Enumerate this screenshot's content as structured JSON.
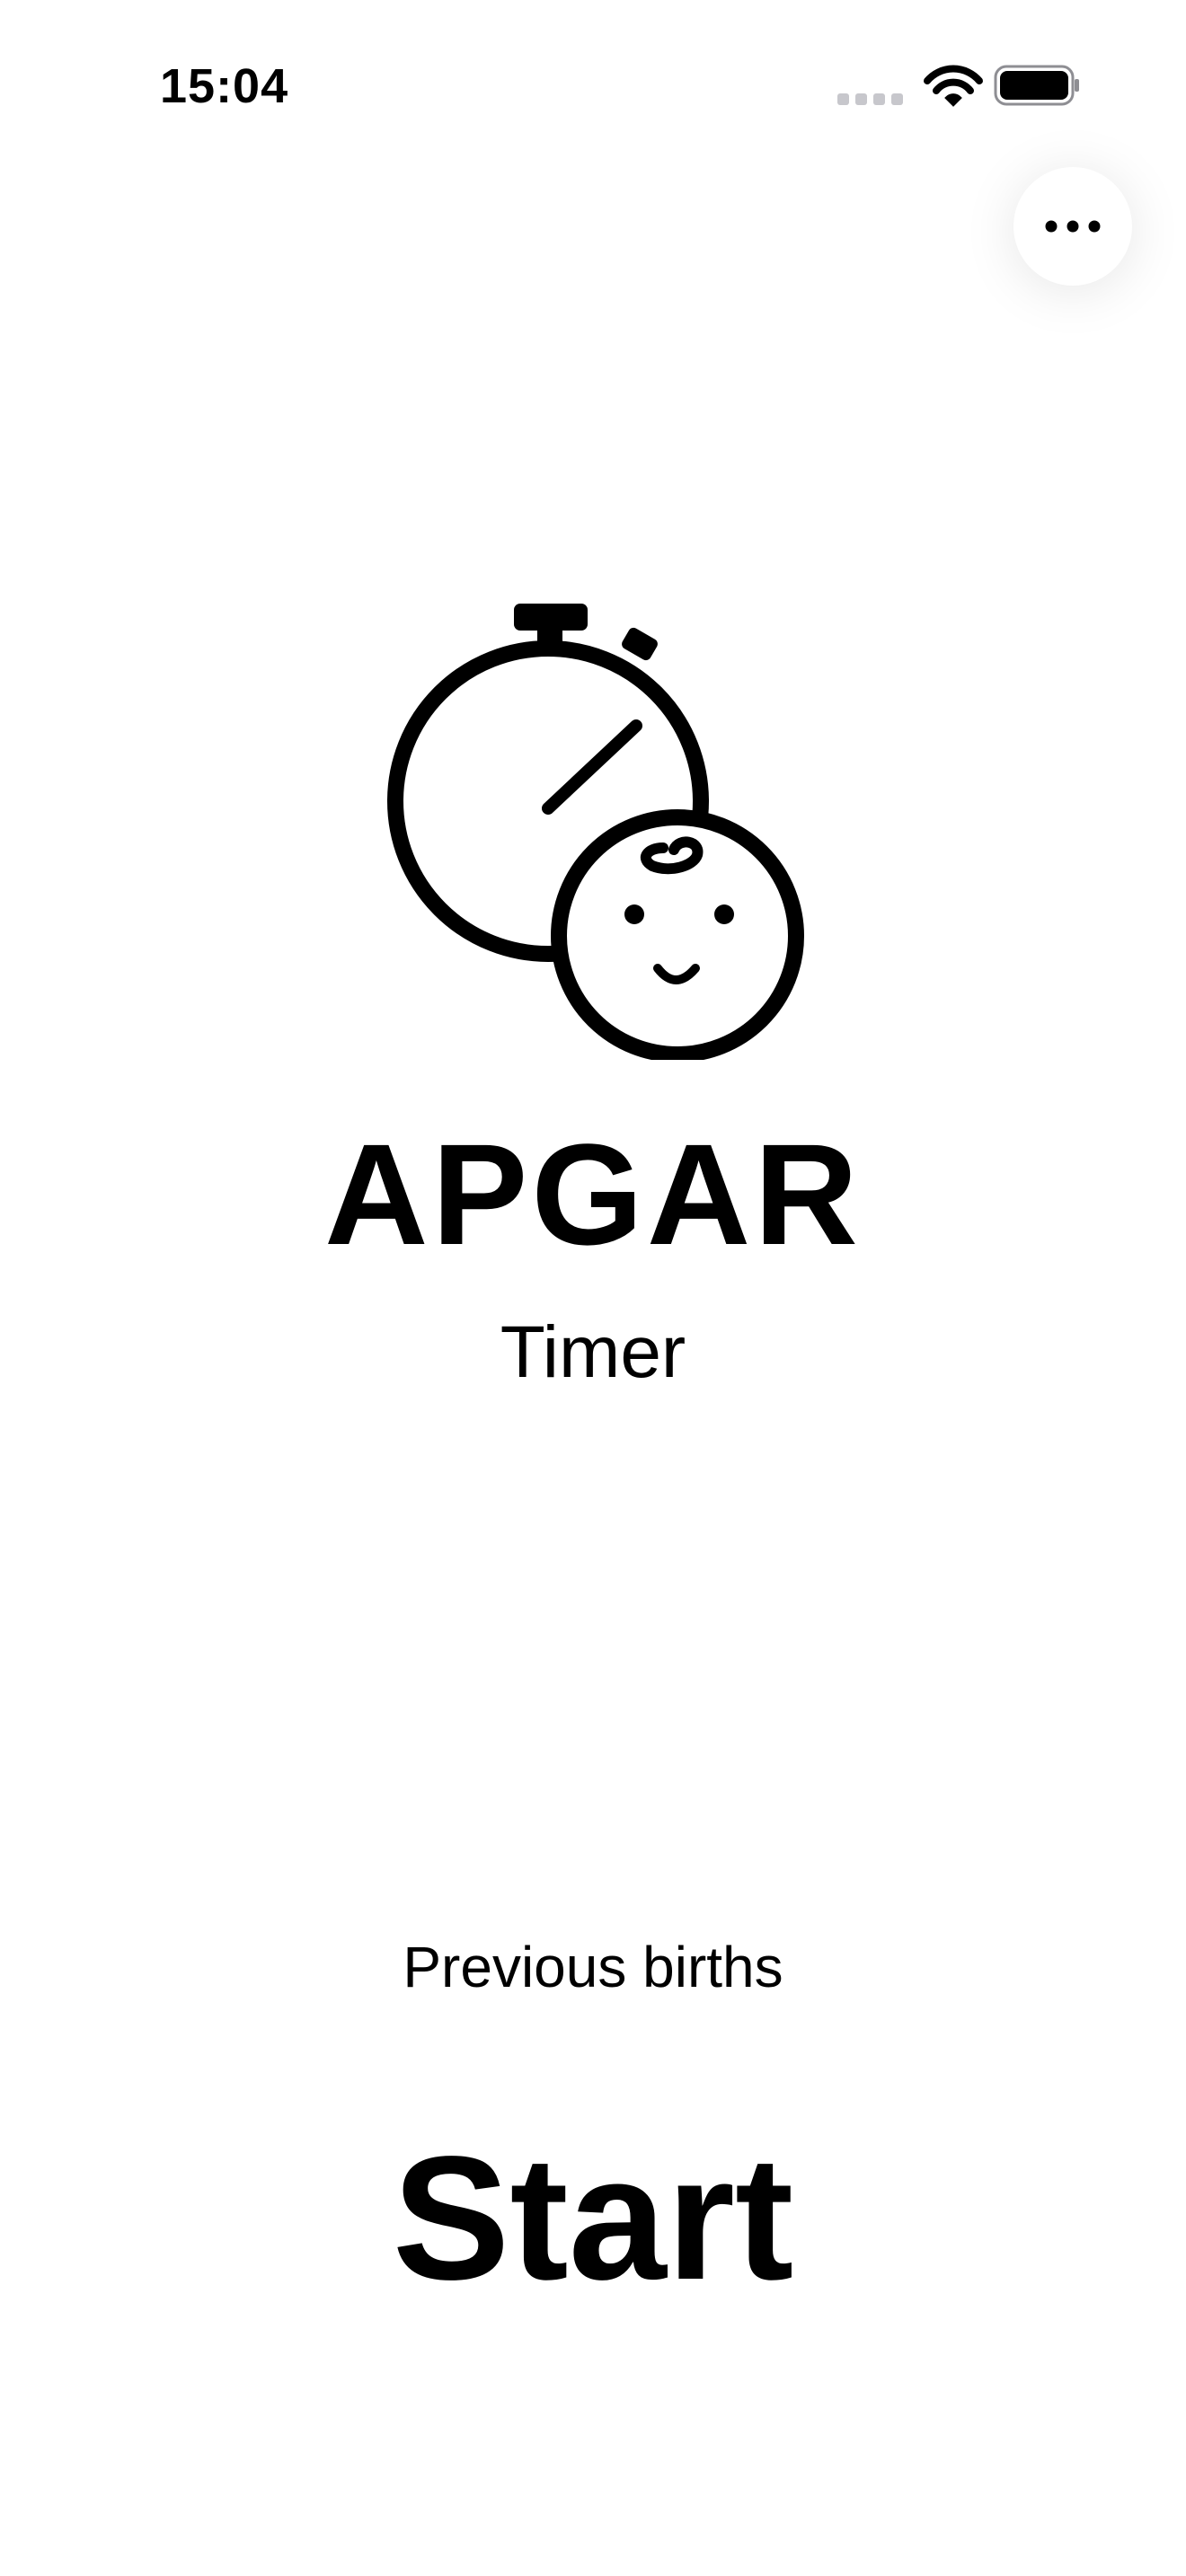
{
  "status_bar": {
    "time": "15:04",
    "icons": [
      "signal-icon",
      "wifi-icon",
      "battery-icon"
    ]
  },
  "menu": {
    "icon": "more-dots-icon"
  },
  "logo": {
    "icon": "stopwatch-baby-icon"
  },
  "title": "APGAR",
  "subtitle": "Timer",
  "previous_births_label": "Previous births",
  "start_label": "Start",
  "colors": {
    "background": "#ffffff",
    "foreground": "#000000"
  }
}
